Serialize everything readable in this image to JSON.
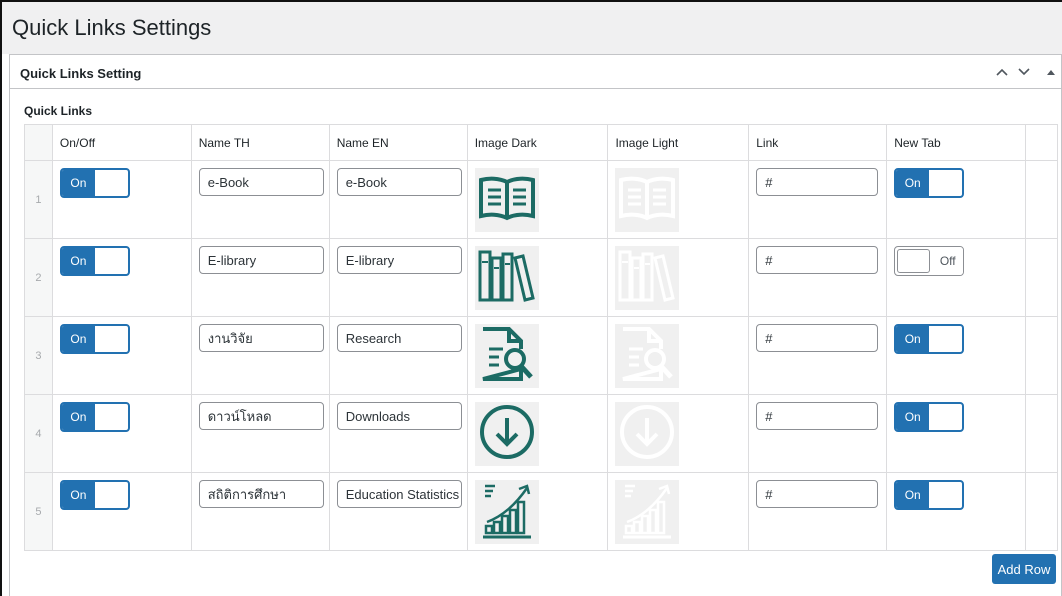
{
  "page": {
    "title": "Quick Links Settings"
  },
  "postbox": {
    "title": "Quick Links Setting"
  },
  "field": {
    "label": "Quick Links"
  },
  "columns": {
    "on_off": "On/Off",
    "name_th": "Name TH",
    "name_en": "Name EN",
    "image_dark": "Image Dark",
    "image_light": "Image Light",
    "link": "Link",
    "new_tab": "New Tab"
  },
  "rows": [
    {
      "num": "1",
      "onoff": "On",
      "name_th": "e-Book",
      "name_en": "e-Book",
      "icon": "book-icon",
      "link": "#",
      "new_tab": "On"
    },
    {
      "num": "2",
      "onoff": "On",
      "name_th": "E-library",
      "name_en": "E-library",
      "icon": "library-icon",
      "link": "#",
      "new_tab": "Off"
    },
    {
      "num": "3",
      "onoff": "On",
      "name_th": "งานวิจัย",
      "name_en": "Research",
      "icon": "research-icon",
      "link": "#",
      "new_tab": "On"
    },
    {
      "num": "4",
      "onoff": "On",
      "name_th": "ดาวน์โหลด",
      "name_en": "Downloads",
      "icon": "download-icon",
      "link": "#",
      "new_tab": "On"
    },
    {
      "num": "5",
      "onoff": "On",
      "name_th": "สถิติการศึกษา",
      "name_en": "Education Statistics",
      "icon": "statistics-icon",
      "link": "#",
      "new_tab": "On"
    }
  ],
  "buttons": {
    "add_row": "Add Row"
  },
  "colors": {
    "accent": "#2271b1",
    "icon_dark": "#1c6b64",
    "icon_light": "#ffffff",
    "icon_bg": "#f0f0f0"
  }
}
